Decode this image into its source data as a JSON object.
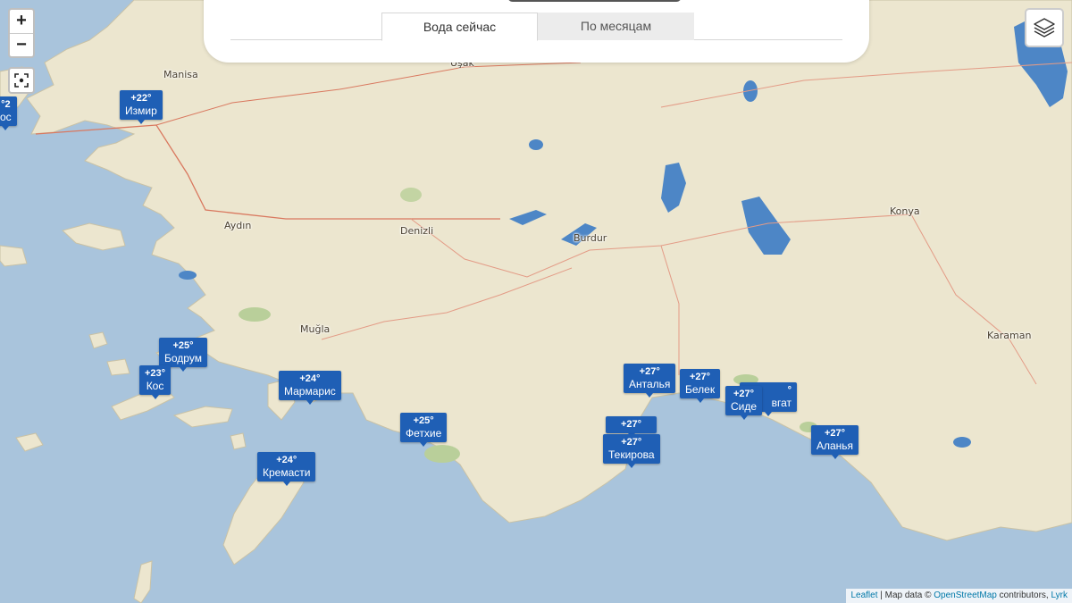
{
  "zoom": {
    "in_label": "+",
    "out_label": "−"
  },
  "controls": {
    "locate_icon": "locate-icon",
    "layers_icon": "layers-icon"
  },
  "tabs": [
    {
      "label": "Вода сейчас",
      "active": true
    },
    {
      "label": "По месяцам",
      "active": false
    }
  ],
  "cities": {
    "manisa": "Manisa",
    "usak": "Uşak",
    "aydin": "Aydın",
    "denizli": "Denizli",
    "burdur": "Burdur",
    "konya": "Konya",
    "mugla": "Muğla",
    "karaman": "Karaman"
  },
  "markers": {
    "edge": {
      "temp": "°2",
      "name": "ос"
    },
    "izmir": {
      "temp": "+22°",
      "name": "Измир"
    },
    "bodrum": {
      "temp": "+25°",
      "name": "Бодрум"
    },
    "kos": {
      "temp": "+23°",
      "name": "Кос"
    },
    "marmaris": {
      "temp": "+24°",
      "name": "Мармарис"
    },
    "fethiye": {
      "temp": "+25°",
      "name": "Фетхие"
    },
    "kremasti": {
      "temp": "+24°",
      "name": "Кремасти"
    },
    "antalya": {
      "temp": "+27°",
      "name": "Анталья"
    },
    "belek": {
      "temp": "+27°",
      "name": "Белек"
    },
    "side": {
      "temp": "+27°",
      "name": "Сиде"
    },
    "manavgat": {
      "temp": "°",
      "name": "вгат"
    },
    "kemer": {
      "temp": "+27°",
      "name": ""
    },
    "tekirova": {
      "temp": "+27°",
      "name": "Текирова"
    },
    "alanya": {
      "temp": "+27°",
      "name": "Аланья"
    }
  },
  "attribution": {
    "leaflet": "Leaflet",
    "separator": " | Map data © ",
    "osm": "OpenStreetMap",
    "contributors": " contributors, ",
    "lyrk": "Lyrk"
  },
  "colors": {
    "sea": "#a9c4dc",
    "land": "#ece6cf",
    "marker": "#1f5fb5",
    "lake": "#4d86c6"
  }
}
